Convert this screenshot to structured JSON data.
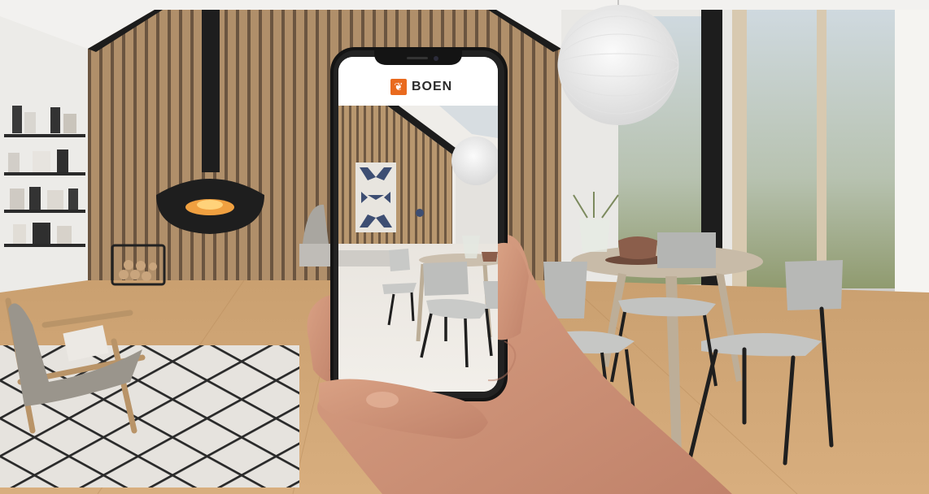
{
  "app": {
    "brand_name": "BOEN",
    "brand_icon": "boen-leaf-icon"
  },
  "colors": {
    "brand_orange": "#e96a1e",
    "wood_floor": "#d3a877",
    "wall_panel": "#a88a68"
  }
}
